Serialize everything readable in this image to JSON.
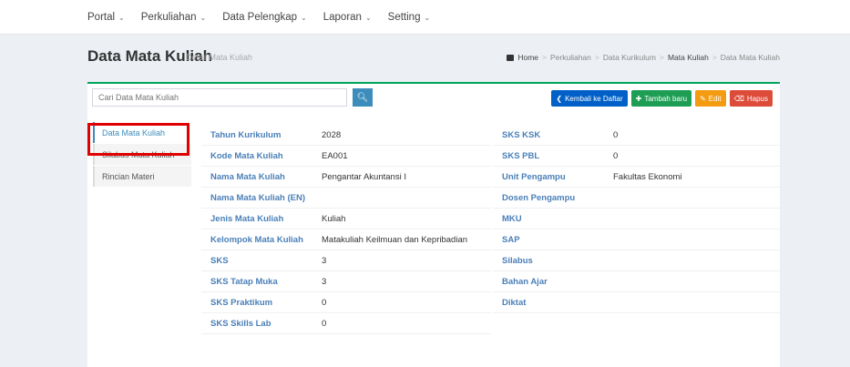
{
  "nav": [
    {
      "label": "Portal"
    },
    {
      "label": "Perkuliahan"
    },
    {
      "label": "Data Pelengkap"
    },
    {
      "label": "Laporan"
    },
    {
      "label": "Setting"
    }
  ],
  "header": {
    "title": "Data Mata Kuliah",
    "subtitle": "Detail Mata Kuliah",
    "breadcrumb": [
      "Home",
      "Perkuliahan",
      "Data Kurikulum",
      "Mata Kuliah",
      "Data Mata Kuliah"
    ]
  },
  "search": {
    "placeholder": "Cari Data Mata Kuliah"
  },
  "actions": {
    "back": "Kembali ke Daftar",
    "add": "Tambah baru",
    "edit": "Edit",
    "delete": "Hapus"
  },
  "side_menu": [
    {
      "label": "Data Mata Kuliah"
    },
    {
      "label": "Silabus Mata Kuliah"
    },
    {
      "label": "Rincian Materi"
    }
  ],
  "details_left": [
    {
      "label": "Tahun Kurikulum",
      "value": "2028"
    },
    {
      "label": "Kode Mata Kuliah",
      "value": "EA001"
    },
    {
      "label": "Nama Mata Kuliah",
      "value": "Pengantar Akuntansi I"
    },
    {
      "label": "Nama Mata Kuliah (EN)",
      "value": ""
    },
    {
      "label": "Jenis Mata Kuliah",
      "value": "Kuliah"
    },
    {
      "label": "Kelompok Mata Kuliah",
      "value": "Matakuliah Keilmuan dan Kepribadian"
    },
    {
      "label": "SKS",
      "value": "3"
    },
    {
      "label": "SKS Tatap Muka",
      "value": "3"
    },
    {
      "label": "SKS Praktikum",
      "value": "0"
    },
    {
      "label": "SKS Skills Lab",
      "value": "0"
    }
  ],
  "details_right": [
    {
      "label": "SKS KSK",
      "value": "0"
    },
    {
      "label": "SKS PBL",
      "value": "0"
    },
    {
      "label": "Unit Pengampu",
      "value": "Fakultas Ekonomi"
    },
    {
      "label": "Dosen Pengampu",
      "value": ""
    },
    {
      "label": "MKU",
      "value": ""
    },
    {
      "label": "SAP",
      "value": ""
    },
    {
      "label": "Silabus",
      "value": ""
    },
    {
      "label": "Bahan Ajar",
      "value": ""
    },
    {
      "label": "Diktat",
      "value": ""
    }
  ]
}
